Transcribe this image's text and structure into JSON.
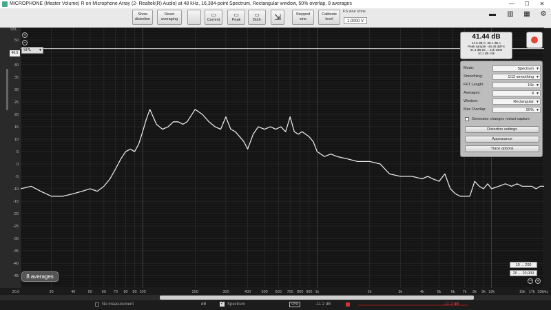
{
  "window": {
    "title": "MICROPHONE (Master Volume) R on Microphone Array (2- Realtek(R) Audio) at 48 kHz, 16,384-point Spectrum, Rectangular window, 50% overlap, 8 averages",
    "minimize": "—",
    "maximize": "☐",
    "close": "✕"
  },
  "toolbar": {
    "show_distortion": "Show distortion",
    "reset_averaging": "Reset averaging",
    "current": "Current",
    "peak": "Peak",
    "both": "Both",
    "stepped_sine": "Stepped sine",
    "calibrate_level": "Calibrate level",
    "fs_sine_label": "FS sine Vrms",
    "fs_sine_value": "1.0000 V"
  },
  "readout": {
    "level": "41.44 dB",
    "line1": "41.5 dB C, 38.1 dB A",
    "line2": "Peak sample: -45.48 dBFS",
    "line3": "41.4 dB Z2 ... 11k 1000",
    "line4": "10.1 dB <5k"
  },
  "spl": {
    "label": "SPL",
    "axis_title": "SPL",
    "marker": "46.5"
  },
  "controls": {
    "mode_label": "Mode:",
    "mode_value": "Spectrum",
    "smoothing_label": "Smoothing:",
    "smoothing_value": "1/12 smoothing",
    "fft_label": "FFT Length:",
    "fft_value": "16k",
    "averages_label": "Averages:",
    "averages_value": "8",
    "window_label": "Window:",
    "window_value": "Rectangular",
    "overlap_label": "Max Overlap:",
    "overlap_value": "50%",
    "generator_checkbox": "Generator changes restart capture",
    "distortion_settings": "Distortion settings",
    "appearance": "Appearance",
    "trace_options": "Trace options"
  },
  "averages_badge": "8 averages",
  "range": {
    "y_range": "10 ... 200",
    "x_range": "20 ... 20,000"
  },
  "status": {
    "no_measurement": "No measurement",
    "db_label": "dB",
    "spectrum": "Spectrum",
    "level_readout": "-11.2 dB",
    "mode_glyph": "V/Hz",
    "right_readout": "-11.2 dB"
  },
  "colors": {
    "plot_bg": "#141414",
    "trace": "#e6e6e6",
    "grid": "#3a3a3a",
    "record": "#e5473a"
  },
  "chart_data": {
    "type": "line",
    "xlabel": "",
    "ylabel": "SPL",
    "xscale": "log",
    "xlim": [
      20,
      20000
    ],
    "ylim": [
      -50,
      55
    ],
    "xtick_labels": [
      "20.0",
      "30",
      "40",
      "50",
      "60",
      "70",
      "80",
      "90",
      "100",
      "200",
      "300",
      "400",
      "500",
      "600",
      "700",
      "800",
      "900",
      "1k",
      "2k",
      "3k",
      "4k",
      "5k",
      "6k",
      "7k",
      "8k",
      "9k",
      "10k",
      "15k",
      "17k",
      "20kHz"
    ],
    "xtick_values": [
      20,
      30,
      40,
      50,
      60,
      70,
      80,
      90,
      100,
      200,
      300,
      400,
      500,
      600,
      700,
      800,
      900,
      1000,
      2000,
      3000,
      4000,
      5000,
      6000,
      7000,
      8000,
      9000,
      10000,
      15000,
      17000,
      20000
    ],
    "yticks": [
      50,
      45,
      40,
      35,
      30,
      25,
      20,
      15,
      10,
      5,
      0,
      -5,
      -10,
      -15,
      -20,
      -25,
      -30,
      -35,
      -40,
      -45
    ],
    "series": [
      {
        "x": [
          20,
          23,
          26,
          30,
          35,
          40,
          45,
          50,
          55,
          60,
          65,
          70,
          75,
          80,
          85,
          90,
          95,
          100,
          105,
          110,
          120,
          130,
          140,
          150,
          160,
          170,
          180,
          200,
          220,
          240,
          260,
          280,
          300,
          320,
          340,
          360,
          380,
          400,
          430,
          460,
          500,
          540,
          580,
          620,
          660,
          700,
          740,
          780,
          820,
          860,
          900,
          950,
          1000,
          1100,
          1200,
          1300,
          1500,
          1700,
          2000,
          2300,
          2600,
          3000,
          3500,
          4000,
          4300,
          4600,
          5000,
          5400,
          5800,
          6200,
          6600,
          7000,
          7500,
          8000,
          8500,
          9000,
          9500,
          10000,
          11000,
          12000,
          13000,
          14000,
          15000,
          16000,
          17000,
          18000,
          19000,
          20000
        ],
        "y": [
          -10,
          -9,
          -11,
          -13,
          -13,
          -12,
          -11,
          -10,
          -11,
          -9,
          -6,
          -2,
          2,
          5,
          6,
          5,
          8,
          13,
          18,
          22,
          16,
          14,
          15,
          17,
          17,
          16,
          17,
          22,
          20,
          17,
          15,
          14,
          19,
          14,
          13,
          11,
          9,
          6,
          12,
          15,
          14,
          15,
          14,
          15,
          13,
          19,
          13,
          12,
          13,
          12,
          11,
          9,
          5,
          3,
          4,
          3,
          2,
          1,
          1,
          0,
          -4,
          -5,
          -5,
          -6,
          -5,
          -6,
          -7,
          -4,
          -10,
          -12,
          -13,
          -13,
          -13,
          -7,
          -9,
          -10,
          -8,
          -10,
          -9,
          -8,
          -9,
          -8,
          -9,
          -9,
          -9,
          -10,
          -9,
          -9
        ]
      }
    ]
  }
}
